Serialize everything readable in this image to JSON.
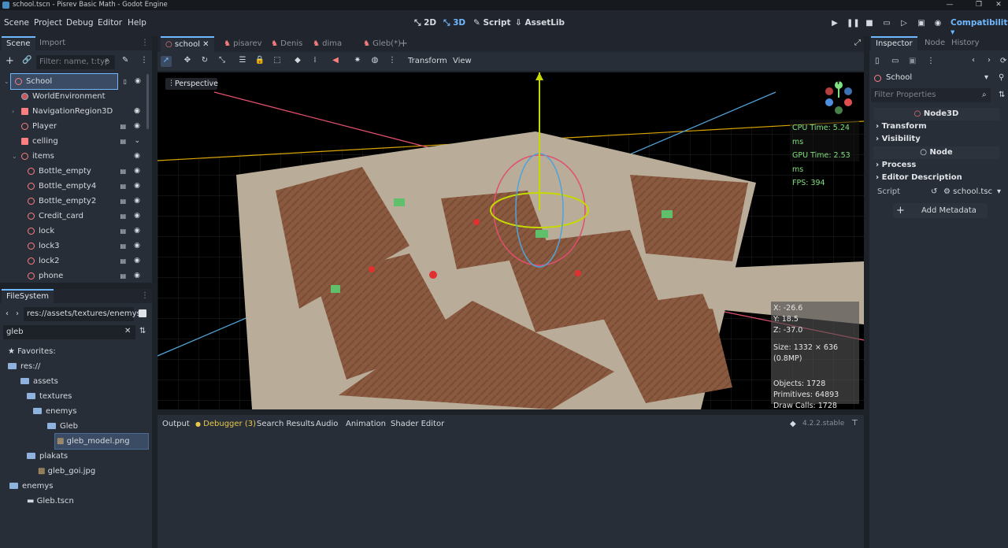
{
  "window": {
    "title": "school.tscn - Pisrev Basic Math - Godot Engine"
  },
  "menu": [
    "Scene",
    "Project",
    "Debug",
    "Editor",
    "Help"
  ],
  "workspaces": [
    {
      "label": "2D",
      "active": false
    },
    {
      "label": "3D",
      "active": true
    },
    {
      "label": "Script",
      "active": false
    },
    {
      "label": "AssetLib",
      "active": false
    }
  ],
  "renderer": "Compatibility",
  "scene_dock": {
    "tabs": [
      "Scene",
      "Import"
    ],
    "filter_placeholder": "Filter: name, t:typ",
    "nodes": [
      {
        "label": "School",
        "depth": 0,
        "selected": true
      },
      {
        "label": "WorldEnvironment",
        "depth": 1
      },
      {
        "label": "NavigationRegion3D",
        "depth": 1
      },
      {
        "label": "Player",
        "depth": 1
      },
      {
        "label": "celling",
        "depth": 1
      },
      {
        "label": "items",
        "depth": 1
      },
      {
        "label": "Bottle_empty",
        "depth": 2
      },
      {
        "label": "Bottle_empty4",
        "depth": 2
      },
      {
        "label": "Bottle_empty2",
        "depth": 2
      },
      {
        "label": "Credit_card",
        "depth": 2
      },
      {
        "label": "lock",
        "depth": 2
      },
      {
        "label": "lock3",
        "depth": 2
      },
      {
        "label": "lock2",
        "depth": 2
      },
      {
        "label": "phone",
        "depth": 2
      }
    ]
  },
  "filesystem": {
    "tab": "FileSystem",
    "path": "res://assets/textures/enemys/",
    "search": "gleb",
    "items": [
      {
        "label": "Favorites:",
        "depth": 0
      },
      {
        "label": "res://",
        "depth": 0
      },
      {
        "label": "assets",
        "depth": 1
      },
      {
        "label": "textures",
        "depth": 2
      },
      {
        "label": "enemys",
        "depth": 3
      },
      {
        "label": "Gleb",
        "depth": 4
      },
      {
        "label": "gleb_model.png",
        "depth": 5,
        "selected": true
      },
      {
        "label": "plakats",
        "depth": 3
      },
      {
        "label": "gleb_goi.jpg",
        "depth": 4
      },
      {
        "label": "enemys",
        "depth": 1
      },
      {
        "label": "Gleb.tscn",
        "depth": 2
      }
    ]
  },
  "editor_tabs": [
    {
      "label": "school",
      "active": true
    },
    {
      "label": "pisarev"
    },
    {
      "label": "Denis"
    },
    {
      "label": "dima"
    },
    {
      "label": "Gleb(*)"
    }
  ],
  "viewport": {
    "menu_transform": "Transform",
    "menu_view": "View",
    "perspective_label": "Perspective",
    "cpu": "CPU Time: 5.24 ms",
    "gpu": "GPU Time: 2.53 ms",
    "fps": "FPS: 394",
    "x": "X: -26.6",
    "y": "Y: 18.5",
    "z": "Z: -37.0",
    "size": "Size: 1332 × 636 (0.8MP)",
    "objects": "Objects: 1728",
    "primitives": "Primitives: 64893",
    "draw_calls": "Draw Calls: 1728",
    "gizmo_label": "Y"
  },
  "bottom_panel": {
    "tabs": [
      "Output",
      "Debugger (3)",
      "Search Results",
      "Audio",
      "Animation",
      "Shader Editor"
    ],
    "version": "4.2.2.stable"
  },
  "inspector": {
    "tabs": [
      "Inspector",
      "Node",
      "History"
    ],
    "node_name": "School",
    "filter_placeholder": "Filter Properties",
    "section_node3d": "Node3D",
    "transform": "Transform",
    "visibility": "Visibility",
    "section_node": "Node",
    "process": "Process",
    "editor_description": "Editor Description",
    "script_label": "Script",
    "script_value": "school.tsc",
    "add_metadata": "Add Metadata"
  }
}
